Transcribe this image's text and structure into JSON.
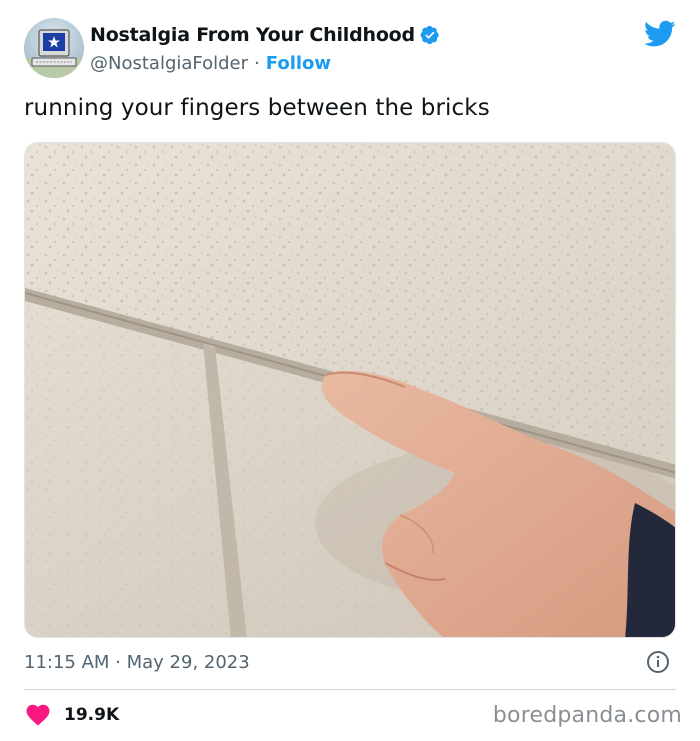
{
  "author": {
    "display_name": "Nostalgia From Your Childhood",
    "handle": "@NostalgiaFolder",
    "separator": "·",
    "follow_label": "Follow",
    "verified": true,
    "avatar_icon": "retro-computer-icon",
    "accent_color": "#1d9bf0"
  },
  "tweet": {
    "text": "running your fingers between the bricks",
    "media_description_icon": "finger-on-brick-wall-photo"
  },
  "meta": {
    "timestamp": "11:15 AM · May 29, 2023",
    "info_icon": "info-icon"
  },
  "engagement": {
    "likes": "19.9K",
    "like_color": "#f91880"
  },
  "branding": {
    "platform_icon": "twitter-bird-icon",
    "watermark": "boredpanda.com"
  }
}
